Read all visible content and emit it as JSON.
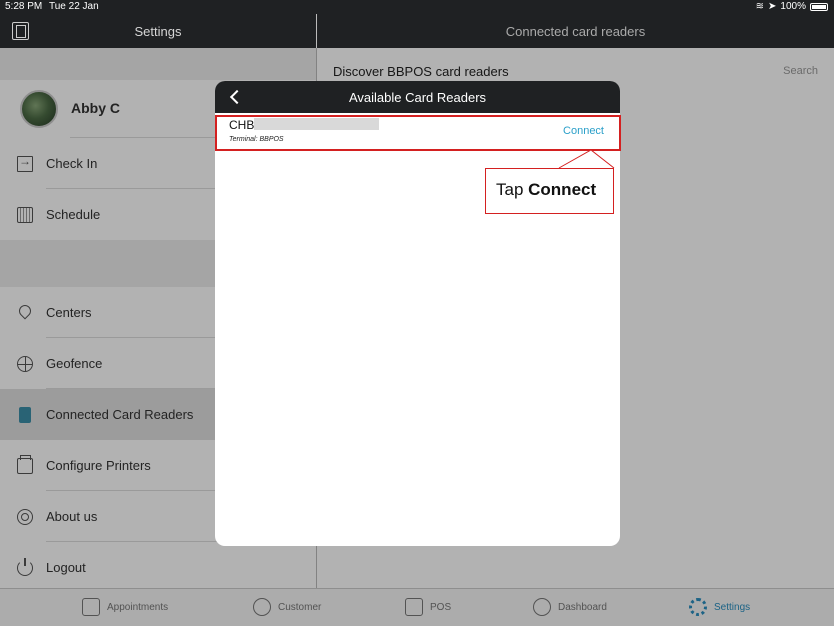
{
  "status_bar": {
    "time": "5:28 PM",
    "date": "Tue 22 Jan",
    "battery": "100%"
  },
  "left_header": {
    "title": "Settings"
  },
  "right_header": {
    "title": "Connected card readers"
  },
  "profile": {
    "name": "Abby C"
  },
  "sidebar": {
    "group1": [
      {
        "label": "Check In",
        "icon": "check-in-icon"
      },
      {
        "label": "Schedule",
        "icon": "calendar-icon"
      }
    ],
    "group2": [
      {
        "label": "Centers",
        "icon": "location-pin-icon"
      },
      {
        "label": "Geofence",
        "icon": "globe-icon"
      },
      {
        "label": "Connected Card Readers",
        "icon": "card-reader-icon",
        "active": true
      },
      {
        "label": "Configure Printers",
        "icon": "printer-icon"
      },
      {
        "label": "About us",
        "icon": "about-icon"
      },
      {
        "label": "Logout",
        "icon": "power-icon"
      }
    ]
  },
  "content": {
    "discover_label": "Discover BBPOS card readers",
    "search_label": "Search"
  },
  "modal": {
    "title": "Available Card Readers",
    "readers": [
      {
        "name": "CHB",
        "terminal": "Terminal: BBPOS",
        "action": "Connect"
      }
    ]
  },
  "annotation": {
    "prefix": "Tap ",
    "emphasis": "Connect",
    "color": "#d42020"
  },
  "tabbar": {
    "tabs": [
      {
        "label": "Appointments",
        "icon": "list-icon"
      },
      {
        "label": "Customer",
        "icon": "person-icon"
      },
      {
        "label": "POS",
        "icon": "calculator-icon"
      },
      {
        "label": "Dashboard",
        "icon": "gauge-icon"
      },
      {
        "label": "Settings",
        "icon": "gear-icon",
        "active": true
      }
    ]
  },
  "colors": {
    "header_bg": "#1f2123",
    "accent": "#2a9fc9",
    "active_row": "#e0e0e0"
  }
}
